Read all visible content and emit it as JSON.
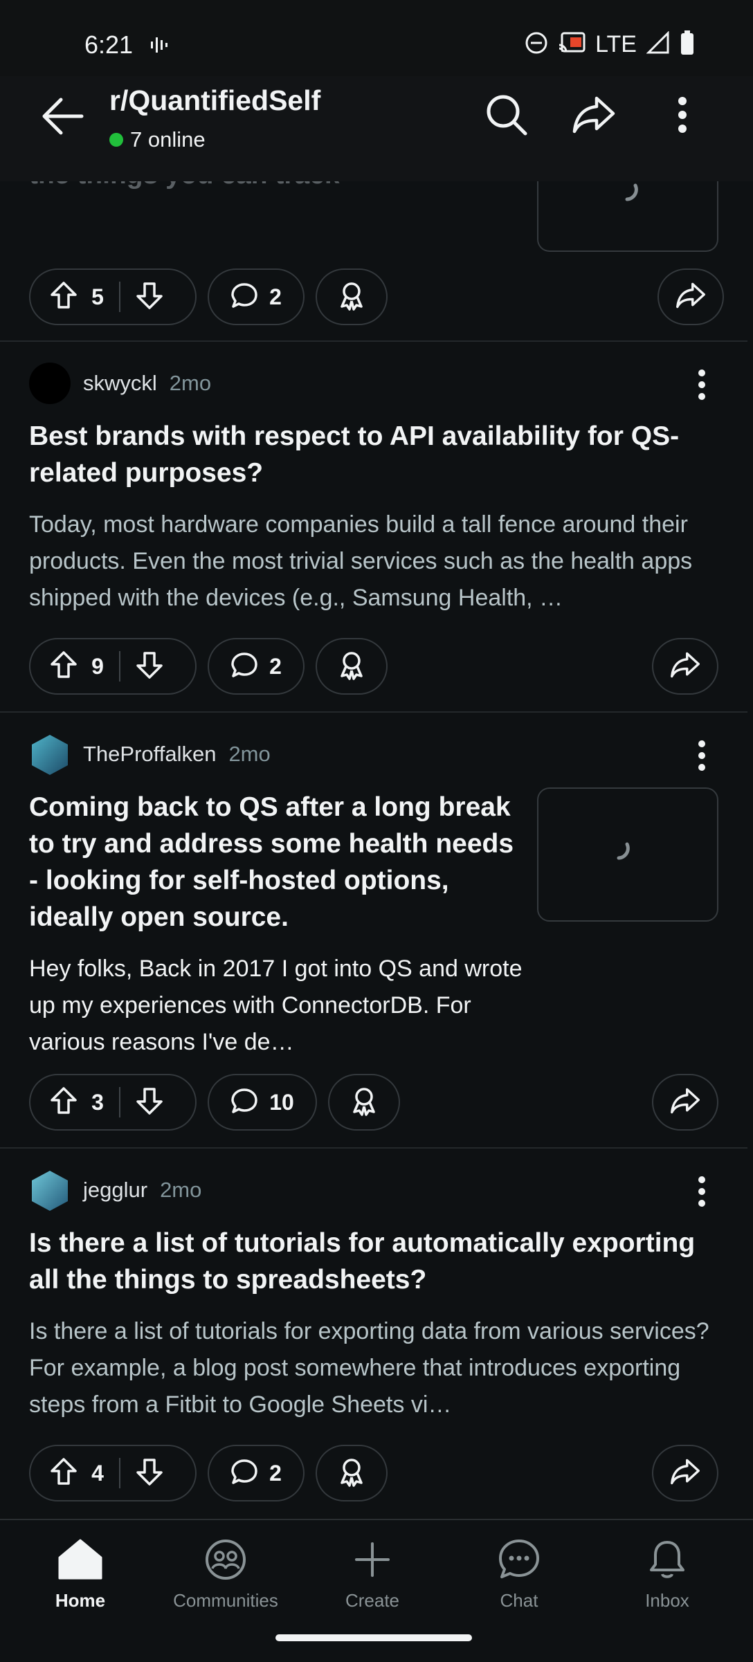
{
  "status_bar": {
    "time": "6:21",
    "network": "LTE"
  },
  "header": {
    "subreddit": "r/QuantifiedSelf",
    "online": "7 online"
  },
  "partial_post": {
    "title_fragment": "the things you can track",
    "upvotes": "5",
    "comments": "2"
  },
  "posts": [
    {
      "author": "skwyckl",
      "age": "2mo",
      "title": "Best brands with respect to API availability for QS-related purposes?",
      "body": "Today, most hardware companies build a tall fence around their products. Even the most trivial services such as the health apps shipped with the devices (e.g., Samsung Health, …",
      "upvotes": "9",
      "comments": "2"
    },
    {
      "author": "TheProffalken",
      "age": "2mo",
      "title": "Coming back to QS after a long break to try and address some health needs - looking for self-hosted options, ideally open source.",
      "body": "Hey folks, Back in 2017 I got into QS and wrote up my experiences with ConnectorDB. For various reasons I've de…",
      "upvotes": "3",
      "comments": "10"
    },
    {
      "author": "jegglur",
      "age": "2mo",
      "title": "Is there a list of tutorials for automatically exporting all the things to spreadsheets?",
      "body": "Is there a list of tutorials for exporting data from various services? For example, a blog post somewhere that introduces exporting steps from a Fitbit to Google Sheets vi…",
      "upvotes": "4",
      "comments": "2"
    }
  ],
  "nav": {
    "home": "Home",
    "communities": "Communities",
    "create": "Create",
    "chat": "Chat",
    "inbox": "Inbox"
  },
  "colors": {
    "background": "#0e1113",
    "online_dot": "#21bf3b",
    "text": "#f2f4f5",
    "muted": "#b8c5c9"
  }
}
